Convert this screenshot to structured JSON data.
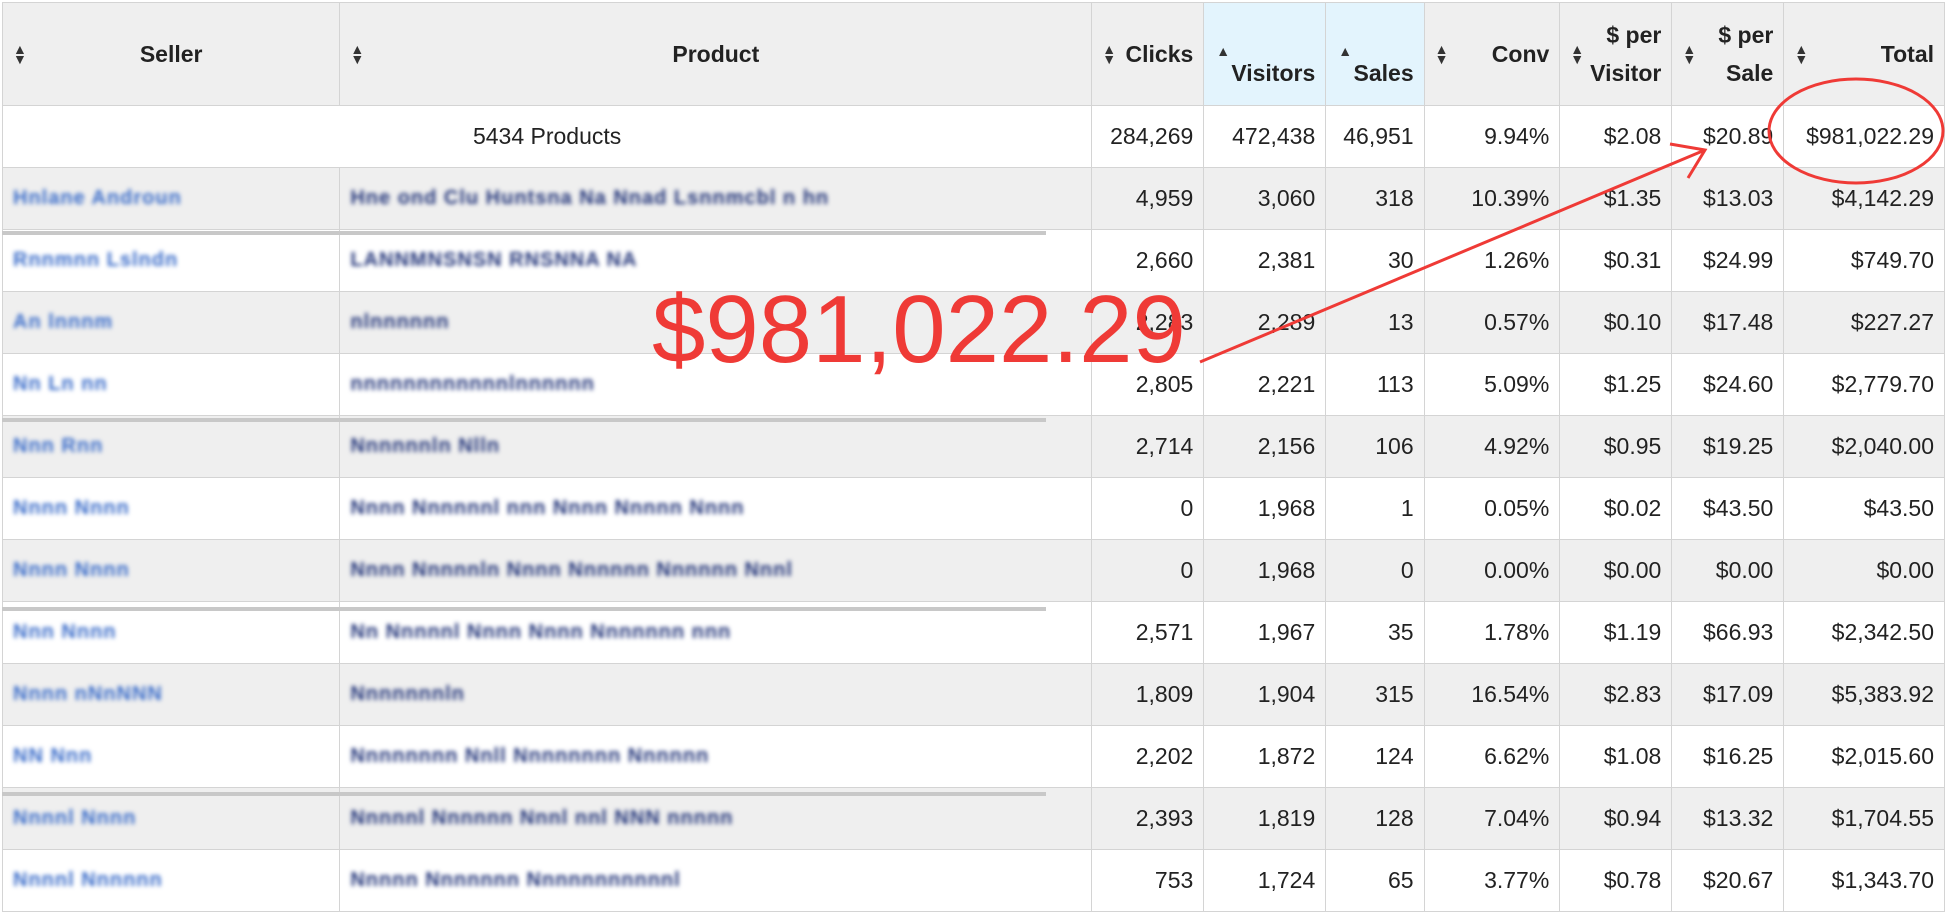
{
  "colors": {
    "annotation": "#ef3a36",
    "header_bg": "#efefef",
    "sorted_header_bg": "#e3f4fd",
    "stripe_bg": "#efefef",
    "link_blue": "#24367a"
  },
  "columns": [
    {
      "key": "seller",
      "label": "Seller",
      "sort_icon": "sort-both-icon"
    },
    {
      "key": "product",
      "label": "Product",
      "sort_icon": "sort-both-icon"
    },
    {
      "key": "clicks",
      "label": "Clicks",
      "sort_icon": "sort-both-icon"
    },
    {
      "key": "visitors",
      "label": "Visitors",
      "sort_icon": "sort-asc-icon"
    },
    {
      "key": "sales",
      "label": "Sales",
      "sort_icon": "sort-asc-icon"
    },
    {
      "key": "conv",
      "label": "Conv",
      "sort_icon": "sort-both-icon"
    },
    {
      "key": "per_visitor",
      "label": "$ per Visitor",
      "sort_icon": "sort-both-icon"
    },
    {
      "key": "per_sale",
      "label": "$ per Sale",
      "sort_icon": "sort-both-icon"
    },
    {
      "key": "total",
      "label": "Total",
      "sort_icon": "sort-both-icon"
    }
  ],
  "totals": {
    "label": "5434 Products",
    "clicks": "284,269",
    "visitors": "472,438",
    "sales": "46,951",
    "conv": "9.94%",
    "per_visitor": "$2.08",
    "per_sale": "$20.89",
    "total": "$981,022.29"
  },
  "rows": [
    {
      "seller": "Hnlane Androun",
      "product": "Hne ond Clu Huntsna Na Nnad Lsnnmcbl n hn",
      "clicks": "4,959",
      "visitors": "3,060",
      "sales": "318",
      "conv": "10.39%",
      "per_visitor": "$1.35",
      "per_sale": "$13.03",
      "total": "$4,142.29"
    },
    {
      "seller": "Rnnmnn Lslndn",
      "product": "LANNMNSNSN RNSNNA NA",
      "clicks": "2,660",
      "visitors": "2,381",
      "sales": "30",
      "conv": "1.26%",
      "per_visitor": "$0.31",
      "per_sale": "$24.99",
      "total": "$749.70"
    },
    {
      "seller": "An lnnnm",
      "product": "nlnnnnnn",
      "clicks": "2,283",
      "visitors": "2,289",
      "sales": "13",
      "conv": "0.57%",
      "per_visitor": "$0.10",
      "per_sale": "$17.48",
      "total": "$227.27"
    },
    {
      "seller": "Nn Ln nn",
      "product": "nnnnnnnnnnnnlnnnnnn",
      "clicks": "2,805",
      "visitors": "2,221",
      "sales": "113",
      "conv": "5.09%",
      "per_visitor": "$1.25",
      "per_sale": "$24.60",
      "total": "$2,779.70"
    },
    {
      "seller": "Nnn Rnn",
      "product": "Nnnnnnln Nlln",
      "clicks": "2,714",
      "visitors": "2,156",
      "sales": "106",
      "conv": "4.92%",
      "per_visitor": "$0.95",
      "per_sale": "$19.25",
      "total": "$2,040.00"
    },
    {
      "seller": "Nnnn Nnnn",
      "product": "Nnnn Nnnnnnl nnn Nnnn Nnnnn Nnnn",
      "clicks": "0",
      "visitors": "1,968",
      "sales": "1",
      "conv": "0.05%",
      "per_visitor": "$0.02",
      "per_sale": "$43.50",
      "total": "$43.50"
    },
    {
      "seller": "Nnnn Nnnn",
      "product": "Nnnn Nnnnnln Nnnn Nnnnnn Nnnnnn Nnnl",
      "clicks": "0",
      "visitors": "1,968",
      "sales": "0",
      "conv": "0.00%",
      "per_visitor": "$0.00",
      "per_sale": "$0.00",
      "total": "$0.00"
    },
    {
      "seller": "Nnn Nnnn",
      "product": "Nn Nnnnnl Nnnn Nnnn Nnnnnnn nnn",
      "clicks": "2,571",
      "visitors": "1,967",
      "sales": "35",
      "conv": "1.78%",
      "per_visitor": "$1.19",
      "per_sale": "$66.93",
      "total": "$2,342.50"
    },
    {
      "seller": "Nnnn nNnNNN",
      "product": "Nnnnnnnln",
      "clicks": "1,809",
      "visitors": "1,904",
      "sales": "315",
      "conv": "16.54%",
      "per_visitor": "$2.83",
      "per_sale": "$17.09",
      "total": "$5,383.92"
    },
    {
      "seller": "NN Nnn",
      "product": "Nnnnnnnn Nnll Nnnnnnnn Nnnnnn",
      "clicks": "2,202",
      "visitors": "1,872",
      "sales": "124",
      "conv": "6.62%",
      "per_visitor": "$1.08",
      "per_sale": "$16.25",
      "total": "$2,015.60"
    },
    {
      "seller": "Nnnnl Nnnn",
      "product": "Nnnnnl Nnnnnn Nnnl nnl NNN nnnnn",
      "clicks": "2,393",
      "visitors": "1,819",
      "sales": "128",
      "conv": "7.04%",
      "per_visitor": "$0.94",
      "per_sale": "$13.32",
      "total": "$1,704.55"
    },
    {
      "seller": "Nnnnl Nnnnnn",
      "product": "Nnnnn Nnnnnnn Nnnnnnnnnnnl",
      "clicks": "753",
      "visitors": "1,724",
      "sales": "65",
      "conv": "3.77%",
      "per_visitor": "$0.78",
      "per_sale": "$20.67",
      "total": "$1,343.70"
    }
  ],
  "annotation": {
    "text": "$981,022.29"
  }
}
